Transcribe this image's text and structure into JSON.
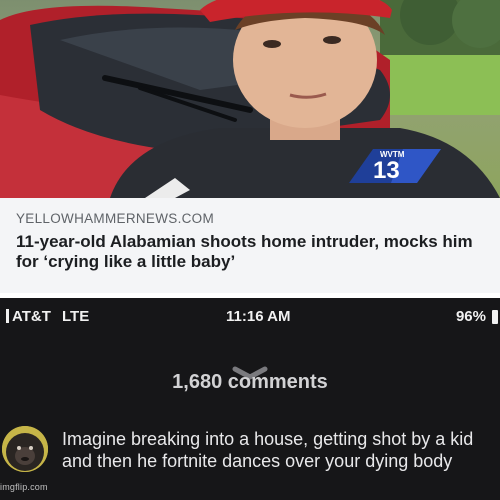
{
  "news": {
    "source": "YELLOWHAMMERNEWS.COM",
    "headline": "11-year-old Alabamian shoots home intruder, mocks him for ‘crying like a little baby’",
    "station_logo": {
      "call_letters": "WVTM",
      "channel": "13"
    }
  },
  "status_bar": {
    "carrier": "AT&T",
    "network": "LTE",
    "time": "11:16 AM",
    "battery": "96%"
  },
  "comments": {
    "header_icon": "chevron-down-icon",
    "count_label": "1,680 comments",
    "items": [
      {
        "avatar_icon": "gorilla-avatar",
        "text": "Imagine breaking into a house, getting shot by a kid and then he fortnite dances over your dying body"
      }
    ]
  },
  "watermark": "imgflip.com",
  "colors": {
    "card_background": "#f4f5f7",
    "headline": "#1c1e21",
    "source": "#5f6368",
    "phone_background": "#161618",
    "phone_text": "#e8e8ea",
    "station_blue": "#1f3f99"
  }
}
